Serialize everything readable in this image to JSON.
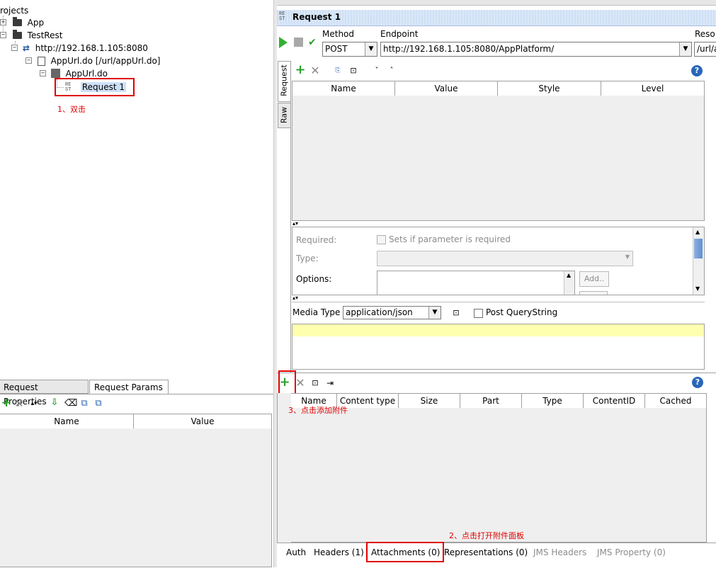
{
  "tree": {
    "root_label": "rojects",
    "items": [
      {
        "label": "App"
      },
      {
        "label": "TestRest"
      },
      {
        "label": "http://192.168.1.105:8080"
      },
      {
        "label": "AppUrl.do [/url/appUrl.do]"
      },
      {
        "label": "AppUrl.do"
      },
      {
        "label": "Request 1"
      }
    ],
    "rest_icon": "RE\nST"
  },
  "annotations": {
    "step1": "1、双击",
    "step2": "2、点击打开附件面板",
    "step3": "3、点击添加附件"
  },
  "left_bottom": {
    "tabs": [
      "Request Properties",
      "Request Params"
    ],
    "columns": [
      "Name",
      "Value"
    ]
  },
  "request": {
    "title": "Request 1",
    "method_label": "Method",
    "method_value": "POST",
    "endpoint_label": "Endpoint",
    "endpoint_value": "http://192.168.1.105:8080/AppPlatform/",
    "resource_label": "Reso",
    "resource_value": "/url/a",
    "side_tabs": [
      "Request",
      "Raw"
    ],
    "param_columns": [
      "Name",
      "Value",
      "Style",
      "Level"
    ],
    "detail": {
      "required_label": "Required:",
      "required_checkbox_label": "Sets if parameter is required",
      "type_label": "Type:",
      "options_label": "Options:",
      "add_label": "Add.."
    },
    "media_type_label": "Media Type",
    "media_type_value": "application/json",
    "post_querystring_label": "Post QueryString"
  },
  "attachments": {
    "columns": [
      "Name",
      "Content type",
      "Size",
      "Part",
      "Type",
      "ContentID",
      "Cached"
    ]
  },
  "bottom_tabs": [
    {
      "label": "Auth",
      "enabled": true
    },
    {
      "label": "Headers (1)",
      "enabled": true
    },
    {
      "label": "Attachments (0)",
      "enabled": true
    },
    {
      "label": "Representations (0)",
      "enabled": true
    },
    {
      "label": "JMS Headers",
      "enabled": false
    },
    {
      "label": "JMS Property (0)",
      "enabled": false
    }
  ],
  "colors": {
    "accent_red": "#e00000",
    "title_bar": "#cfe0f5",
    "json_editor_bg": "#ffffb0",
    "selected_tree": "#cde0f7"
  }
}
